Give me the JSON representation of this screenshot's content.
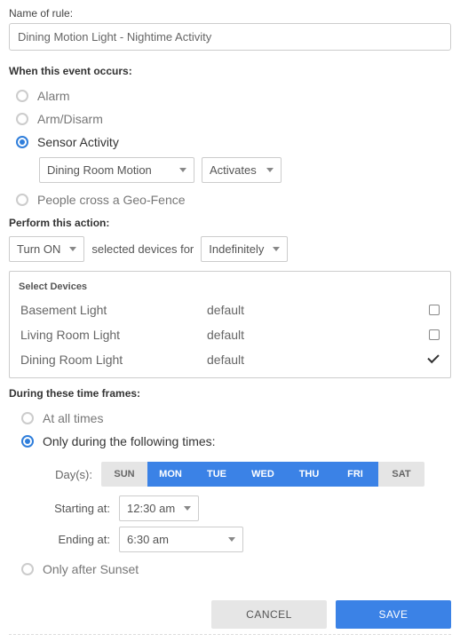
{
  "nameLabel": "Name of rule:",
  "nameValue": "Dining Motion Light - Nightime Activity",
  "eventTitle": "When this event occurs:",
  "events": {
    "alarm": "Alarm",
    "armDisarm": "Arm/Disarm",
    "sensor": "Sensor Activity",
    "geo": "People cross a Geo-Fence"
  },
  "sensorDevice": "Dining Room Motion",
  "sensorAction": "Activates",
  "actionTitle": "Perform this action:",
  "actionSelect": "Turn ON",
  "actionMid": "selected devices for",
  "actionDuration": "Indefinitely",
  "devicesTitle": "Select Devices",
  "devices": [
    {
      "name": "Basement Light",
      "value": "default",
      "checked": false
    },
    {
      "name": "Living Room Light",
      "value": "default",
      "checked": false
    },
    {
      "name": "Dining Room Light",
      "value": "default",
      "checked": true
    }
  ],
  "timeTitle": "During these time frames:",
  "timeOptions": {
    "all": "At all times",
    "only": "Only during the following times:",
    "sunset": "Only after Sunset"
  },
  "daysLabel": "Day(s):",
  "days": [
    {
      "label": "SUN",
      "on": false
    },
    {
      "label": "MON",
      "on": true
    },
    {
      "label": "TUE",
      "on": true
    },
    {
      "label": "WED",
      "on": true
    },
    {
      "label": "THU",
      "on": true
    },
    {
      "label": "FRI",
      "on": true
    },
    {
      "label": "SAT",
      "on": false
    }
  ],
  "startLabel": "Starting at:",
  "startValue": "12:30 am",
  "endLabel": "Ending at:",
  "endValue": "6:30 am",
  "cancel": "CANCEL",
  "save": "SAVE"
}
